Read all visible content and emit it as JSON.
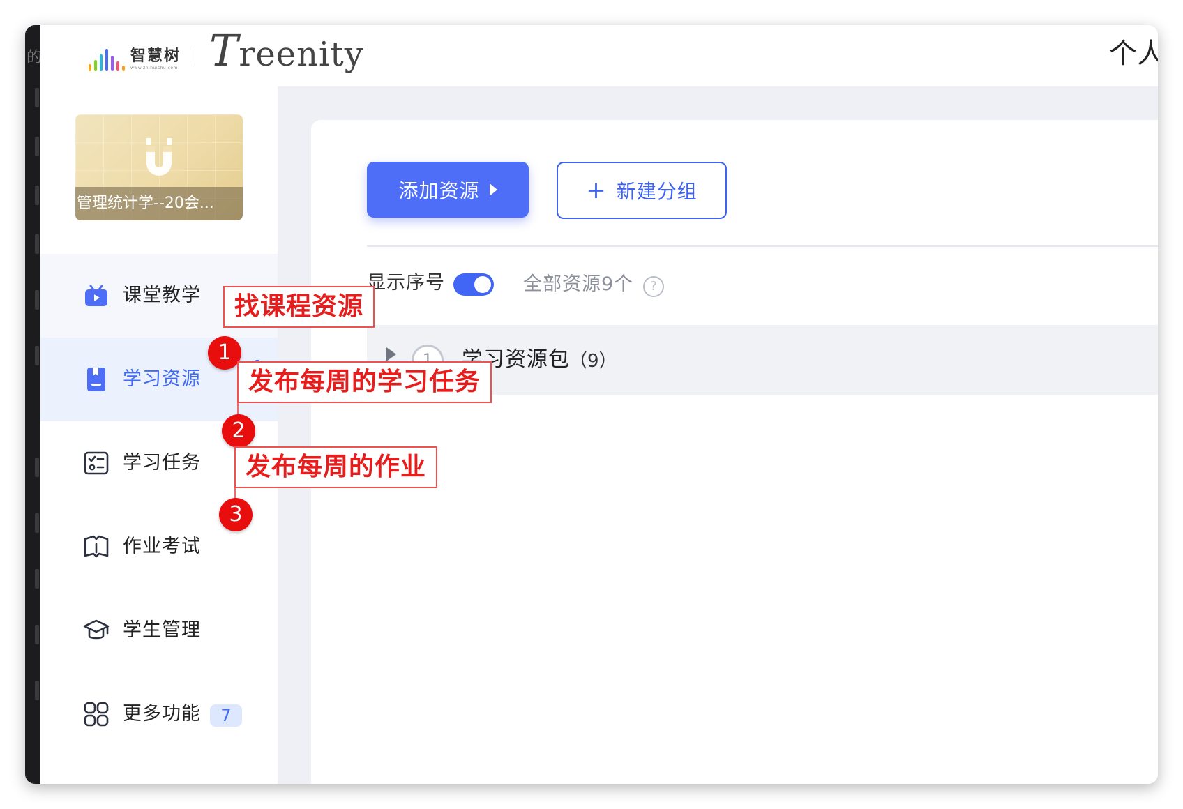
{
  "header": {
    "logo_cn": "智慧树",
    "logo_en": "www.zhihuishu.com",
    "brand": "Treenity",
    "brand_initial": "T",
    "brand_rest": "reenity",
    "personal_center": "个人"
  },
  "sidebar": {
    "course_title": "管理统计学--20会...",
    "items": [
      {
        "label": "课堂教学",
        "icon": "video-icon"
      },
      {
        "label": "学习资源",
        "icon": "book-icon",
        "active": true
      },
      {
        "label": "学习任务",
        "icon": "checklist-icon"
      },
      {
        "label": "作业考试",
        "icon": "open-book-icon"
      },
      {
        "label": "学生管理",
        "icon": "graduation-cap-icon"
      },
      {
        "label": "更多功能",
        "icon": "grid-icon",
        "count": "7"
      }
    ]
  },
  "main": {
    "add_resource_label": "添加资源",
    "new_group_label": "新建分组",
    "show_sequence_label": "显示序号",
    "show_sequence_on": true,
    "total_resources_label": "全部资源9个",
    "help_symbol": "?",
    "groups": [
      {
        "index": "1",
        "name": "学习资源包",
        "count": "（9）"
      }
    ]
  },
  "annotations": [
    {
      "number": "1",
      "text": "找课程资源"
    },
    {
      "number": "2",
      "text": "发布每周的学习任务"
    },
    {
      "number": "3",
      "text": "发布每周的作业"
    }
  ],
  "colors": {
    "accent": "#4f6ef7",
    "active_bg": "#ecf1fe",
    "annotation_red": "#e51d1d",
    "card_gold": "#eedba8"
  }
}
